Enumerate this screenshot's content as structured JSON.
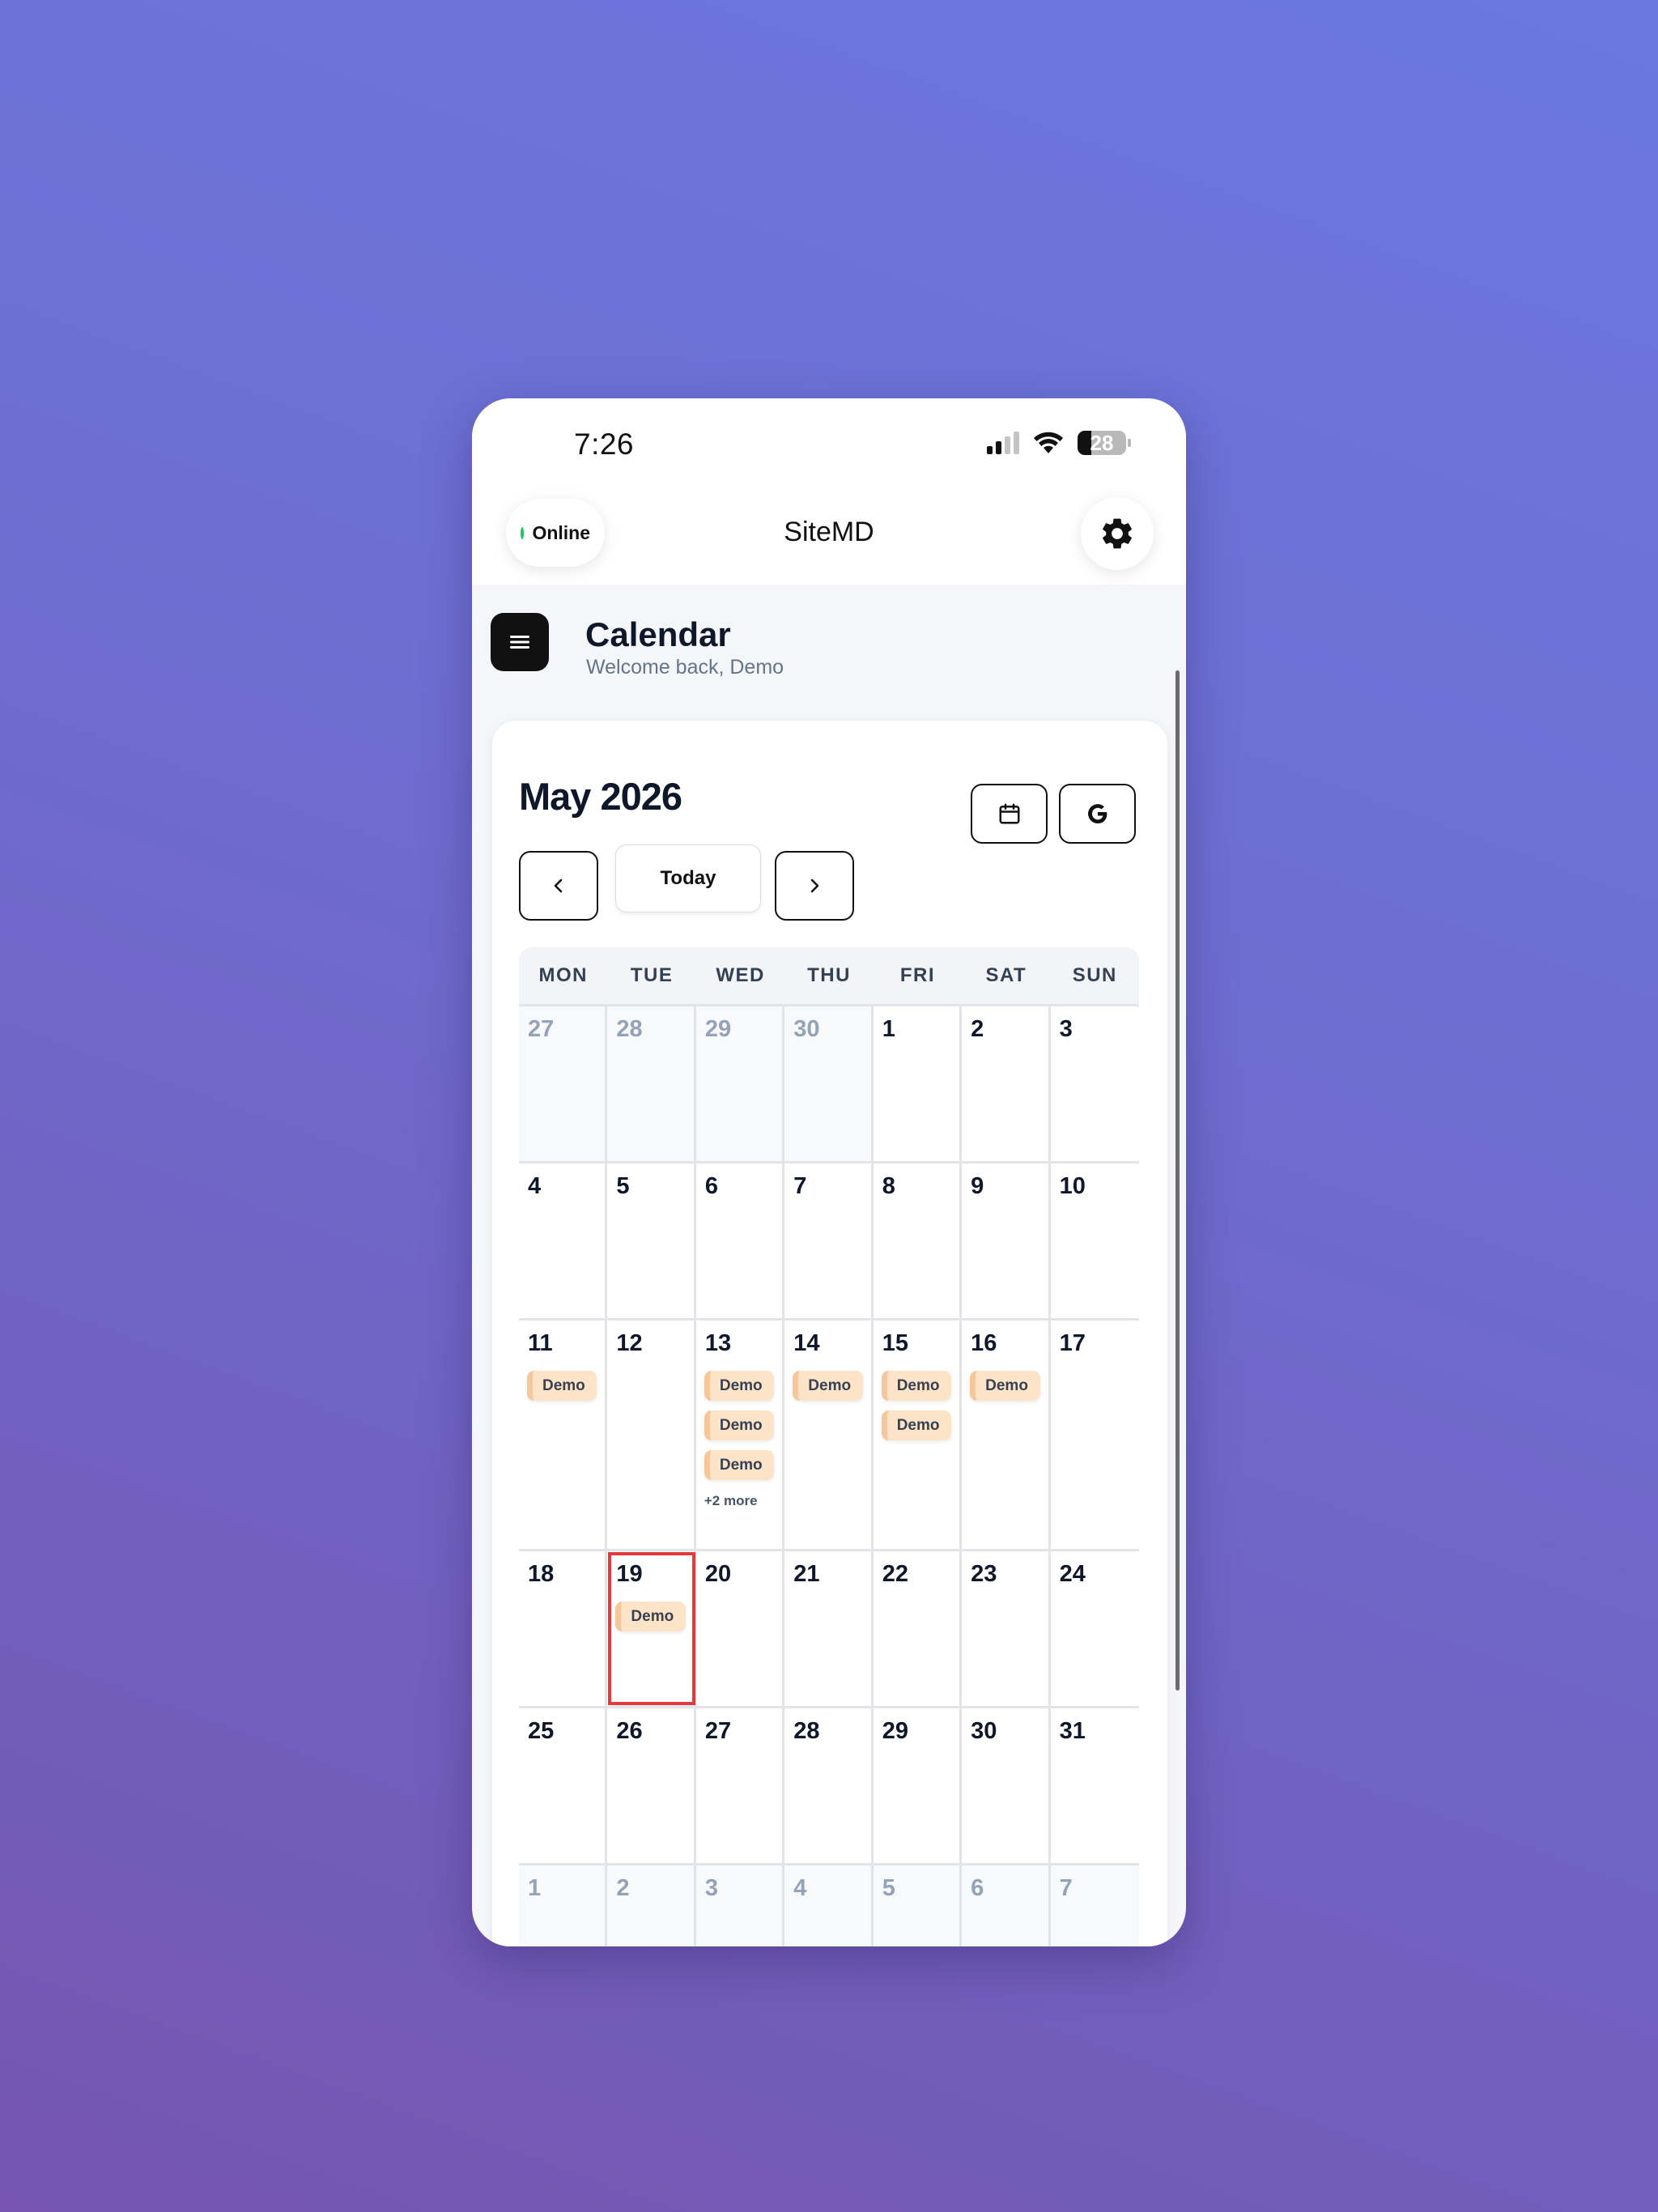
{
  "status_bar": {
    "time": "7:26",
    "battery": "28"
  },
  "header": {
    "status_label": "Online",
    "app_title": "SiteMD"
  },
  "page": {
    "title": "Calendar",
    "subtitle": "Welcome back, Demo"
  },
  "calendar": {
    "month_title": "May 2026",
    "today_label": "Today",
    "weekdays": [
      "MON",
      "TUE",
      "WED",
      "THU",
      "FRI",
      "SAT",
      "SUN"
    ],
    "weeks": [
      [
        {
          "d": "27",
          "out": true
        },
        {
          "d": "28",
          "out": true
        },
        {
          "d": "29",
          "out": true
        },
        {
          "d": "30",
          "out": true
        },
        {
          "d": "1"
        },
        {
          "d": "2"
        },
        {
          "d": "3"
        }
      ],
      [
        {
          "d": "4"
        },
        {
          "d": "5"
        },
        {
          "d": "6"
        },
        {
          "d": "7"
        },
        {
          "d": "8"
        },
        {
          "d": "9"
        },
        {
          "d": "10"
        }
      ],
      [
        {
          "d": "11",
          "events": [
            "Demo"
          ]
        },
        {
          "d": "12"
        },
        {
          "d": "13",
          "events": [
            "Demo",
            "Demo",
            "Demo"
          ],
          "more": "+2 more"
        },
        {
          "d": "14",
          "events": [
            "Demo"
          ]
        },
        {
          "d": "15",
          "events": [
            "Demo",
            "Demo"
          ]
        },
        {
          "d": "16",
          "events": [
            "Demo"
          ]
        },
        {
          "d": "17"
        }
      ],
      [
        {
          "d": "18"
        },
        {
          "d": "19",
          "today": true,
          "events": [
            "Demo"
          ]
        },
        {
          "d": "20"
        },
        {
          "d": "21"
        },
        {
          "d": "22"
        },
        {
          "d": "23"
        },
        {
          "d": "24"
        }
      ],
      [
        {
          "d": "25"
        },
        {
          "d": "26"
        },
        {
          "d": "27"
        },
        {
          "d": "28"
        },
        {
          "d": "29"
        },
        {
          "d": "30"
        },
        {
          "d": "31"
        }
      ],
      [
        {
          "d": "1",
          "out": true
        },
        {
          "d": "2",
          "out": true
        },
        {
          "d": "3",
          "out": true
        },
        {
          "d": "4",
          "out": true
        },
        {
          "d": "5",
          "out": true
        },
        {
          "d": "6",
          "out": true
        },
        {
          "d": "7",
          "out": true
        }
      ]
    ]
  },
  "icons": {
    "settings": "gear-icon",
    "menu": "menu-icon",
    "calendar_view": "calendar-icon",
    "google": "google-icon",
    "prev": "chevron-left-icon",
    "next": "chevron-right-icon"
  },
  "colors": {
    "online_dot": "#22c55e",
    "today_outline": "#e33b3b",
    "event_bg": "#fde4c8",
    "event_accent": "#f6c79a"
  }
}
